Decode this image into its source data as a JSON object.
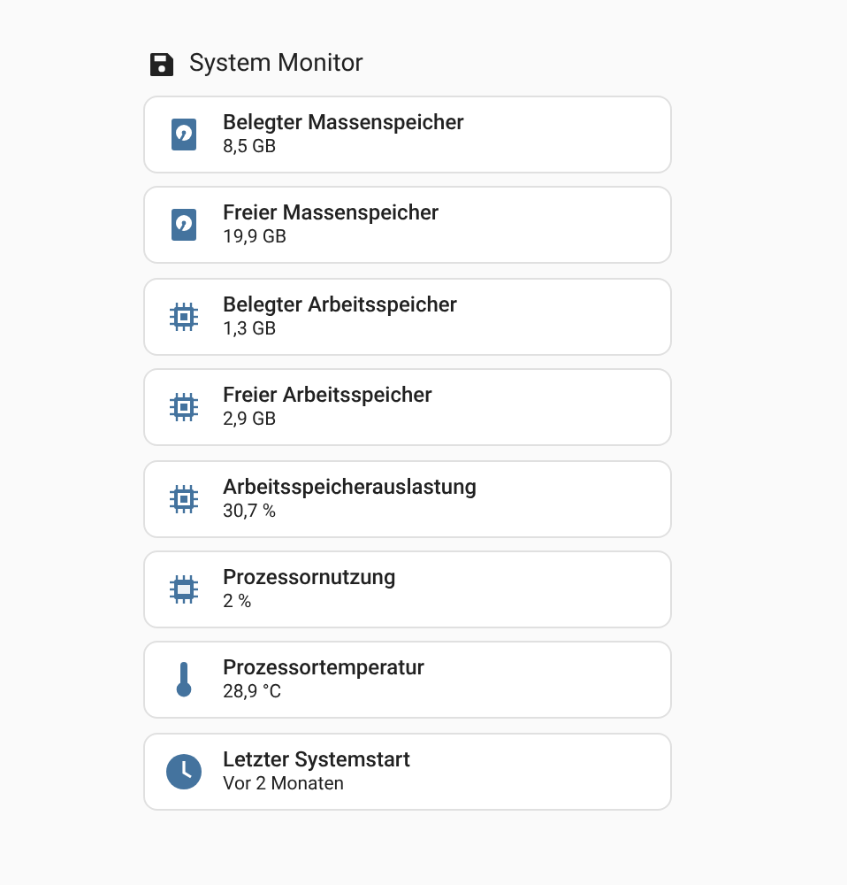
{
  "title": "System Monitor",
  "items": [
    {
      "kind": "disk",
      "label": "Belegter Massenspeicher",
      "value": "8,5 GB"
    },
    {
      "kind": "disk",
      "label": "Freier Massenspeicher",
      "value": "19,9 GB"
    },
    {
      "kind": "memory",
      "label": "Belegter Arbeitsspeicher",
      "value": "1,3 GB"
    },
    {
      "kind": "memory",
      "label": "Freier Arbeitsspeicher",
      "value": "2,9 GB"
    },
    {
      "kind": "memory",
      "label": "Arbeitsspeicherauslastung",
      "value": "30,7 %"
    },
    {
      "kind": "cpu",
      "label": "Prozessornutzung",
      "value": "2 %"
    },
    {
      "kind": "thermometer",
      "label": "Prozessortemperatur",
      "value": "28,9 °C"
    },
    {
      "kind": "clock",
      "label": "Letzter Systemstart",
      "value": "Vor 2 Monaten"
    }
  ]
}
